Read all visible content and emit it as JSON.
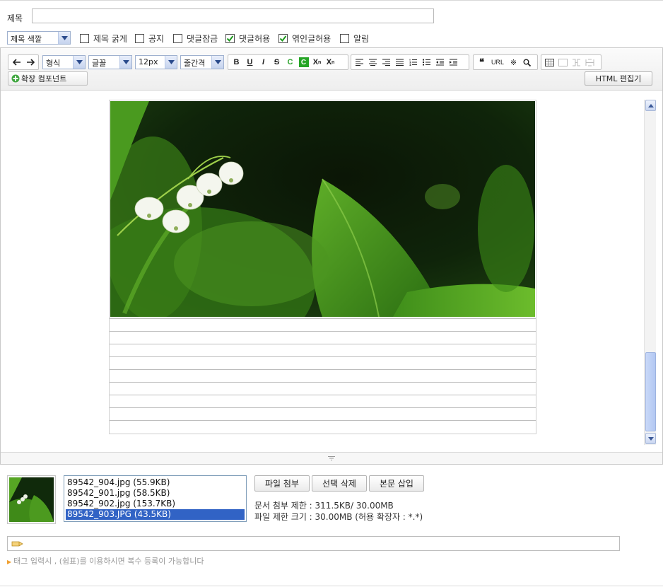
{
  "title_row": {
    "label": "제목",
    "value": ""
  },
  "options": {
    "title_color": "제목 색깔",
    "bold_title": {
      "label": "제목 굵게",
      "checked": false
    },
    "notice": {
      "label": "공지",
      "checked": false
    },
    "lock_comments": {
      "label": "댓글잠금",
      "checked": false
    },
    "allow_comments": {
      "label": "댓글허용",
      "checked": true
    },
    "allow_trackbacks": {
      "label": "엮인글허용",
      "checked": true
    },
    "notify": {
      "label": "알림",
      "checked": false
    }
  },
  "toolbar": {
    "format": "형식",
    "font": "글꼴",
    "size": "12px",
    "line_height": "줄간격",
    "bold": "B",
    "underline": "U",
    "italic": "I",
    "strike": "S",
    "font_color": "C",
    "bg_color": "C",
    "sup": "X",
    "sub": "X",
    "url": "URL",
    "special_char": "※",
    "extension": "확장 컴포넌트",
    "html_editor": "HTML 편집기"
  },
  "attachments": {
    "files": [
      {
        "name": "89542_904.jpg (55.9KB)",
        "selected": false
      },
      {
        "name": "89542_901.jpg (58.5KB)",
        "selected": false
      },
      {
        "name": "89542_902.jpg (153.7KB)",
        "selected": false
      },
      {
        "name": "89542_903.JPG (43.5KB)",
        "selected": true
      }
    ],
    "attach_button": "파일 첨부",
    "delete_button": "선택 삭제",
    "insert_button": "본문 삽입",
    "doc_limit": "문서 첨부 제한 : 311.5KB/ 30.00MB",
    "file_limit": "파일 제한 크기 : 30.00MB (허용 확장자 : *.*)"
  },
  "tags": {
    "value": "",
    "hint": "태그 입력시 , (쉼표)를 이용하시면 복수 등록이 가능합니다"
  },
  "colors": {
    "selection": "#3163c5",
    "accent_green": "#2fa42f",
    "select_border": "#9fb1cf"
  }
}
